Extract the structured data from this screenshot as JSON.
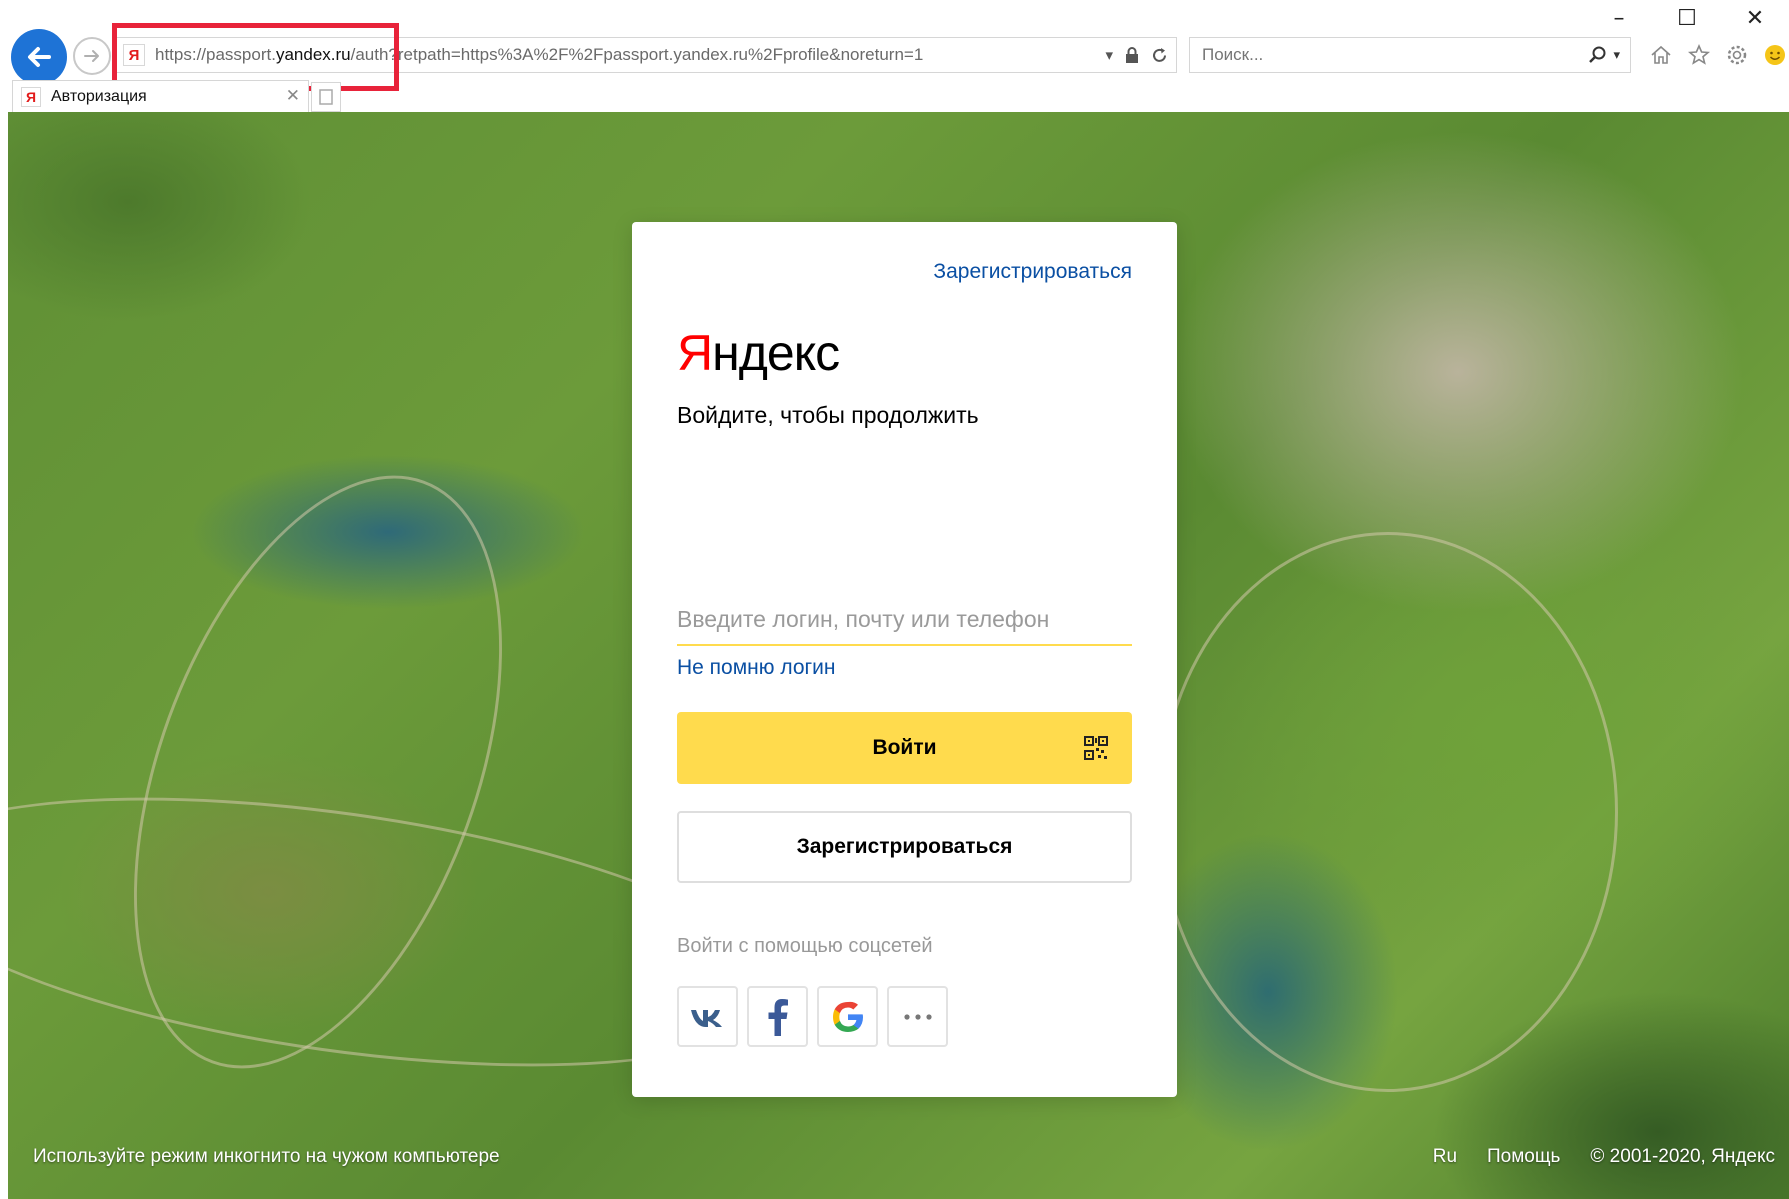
{
  "browser": {
    "url_prefix": "https://passport.",
    "url_host": "yandex.ru",
    "url_rest": "/auth?retpath=https%3A%2F%2Fpassport.yandex.ru%2Fprofile&noreturn=1",
    "search_placeholder": "Поиск...",
    "tab_title": "Авторизация",
    "favicon_letter": "Я",
    "window_minimize": "–",
    "window_maximize": "☐",
    "window_close": "✕",
    "tab_close": "✕"
  },
  "card": {
    "register_link": "Зарегистрироваться",
    "logo_first": "Я",
    "logo_rest": "ндекс",
    "subtitle": "Войдите, чтобы продолжить",
    "login_placeholder": "Введите логин, почту или телефон",
    "forgot_login": "Не помню логин",
    "login_button": "Войти",
    "register_button": "Зарегистрироваться",
    "social_label": "Войти с помощью соцсетей",
    "social": [
      "vk-icon",
      "facebook-icon",
      "google-icon",
      "more-icon"
    ]
  },
  "footer": {
    "incognito_hint": "Используйте режим инкогнито на чужом компьютере",
    "lang": "Ru",
    "help": "Помощь",
    "copyright": "© 2001-2020, Яндекс"
  },
  "colors": {
    "accent_yellow": "#ffdb4d",
    "link_blue": "#0a4fa3",
    "logo_red": "#ff0000",
    "browser_back": "#1e73d6",
    "highlight_red": "#e8233a"
  }
}
